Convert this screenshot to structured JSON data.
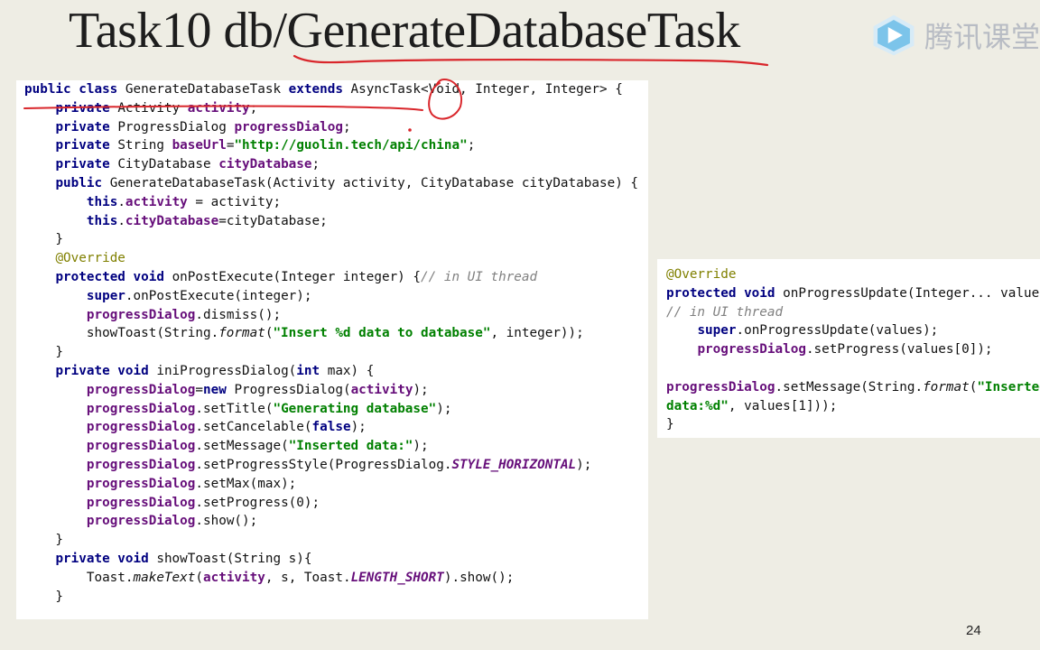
{
  "slide": {
    "title": "Task10 db/GenerateDatabaseTask",
    "page_number": "24"
  },
  "logo": {
    "text": "腾讯课堂",
    "icon": "play-icon"
  },
  "colors": {
    "background": "#eeede4",
    "keyword": "#000080",
    "field": "#660e7a",
    "string": "#008000",
    "comment": "#808080",
    "annotation": "#808000",
    "ink": "#d9262b"
  },
  "code_main": [
    [
      [
        "kw",
        "public class "
      ],
      [
        "",
        "GenerateDatabaseTask "
      ],
      [
        "kw",
        "extends "
      ],
      [
        "",
        "AsyncTask<Void, Integer, Integer> {"
      ]
    ],
    [
      [
        "",
        "    "
      ],
      [
        "kw",
        "private "
      ],
      [
        "",
        "Activity "
      ],
      [
        "fld",
        "activity"
      ],
      [
        "",
        ";"
      ]
    ],
    [
      [
        "",
        "    "
      ],
      [
        "kw",
        "private "
      ],
      [
        "",
        "ProgressDialog "
      ],
      [
        "fld",
        "progressDialog"
      ],
      [
        "",
        ";"
      ]
    ],
    [
      [
        "",
        "    "
      ],
      [
        "kw",
        "private "
      ],
      [
        "",
        "String "
      ],
      [
        "fld",
        "baseUrl"
      ],
      [
        "",
        "="
      ],
      [
        "str",
        "\"http://guolin.tech/api/china\""
      ],
      [
        "",
        ";"
      ]
    ],
    [
      [
        "",
        "    "
      ],
      [
        "kw",
        "private "
      ],
      [
        "",
        "CityDatabase "
      ],
      [
        "fld",
        "cityDatabase"
      ],
      [
        "",
        ";"
      ]
    ],
    [
      [
        "",
        "    "
      ],
      [
        "kw",
        "public "
      ],
      [
        "",
        "GenerateDatabaseTask(Activity activity, CityDatabase cityDatabase) {"
      ]
    ],
    [
      [
        "",
        "        "
      ],
      [
        "kw",
        "this"
      ],
      [
        "",
        "."
      ],
      [
        "fld",
        "activity"
      ],
      [
        "",
        " = activity;"
      ]
    ],
    [
      [
        "",
        "        "
      ],
      [
        "kw",
        "this"
      ],
      [
        "",
        "."
      ],
      [
        "fld",
        "cityDatabase"
      ],
      [
        "",
        "=cityDatabase;"
      ]
    ],
    [
      [
        "",
        "    }"
      ]
    ],
    [
      [
        "",
        "    "
      ],
      [
        "ann",
        "@Override"
      ]
    ],
    [
      [
        "",
        "    "
      ],
      [
        "kw",
        "protected void "
      ],
      [
        "",
        "onPostExecute(Integer integer) {"
      ],
      [
        "cmt",
        "// in UI thread"
      ]
    ],
    [
      [
        "",
        "        "
      ],
      [
        "kw",
        "super"
      ],
      [
        "",
        ".onPostExecute(integer);"
      ]
    ],
    [
      [
        "",
        "        "
      ],
      [
        "fld",
        "progressDialog"
      ],
      [
        "",
        ".dismiss();"
      ]
    ],
    [
      [
        "",
        "        showToast(String."
      ],
      [
        "itl",
        "format"
      ],
      [
        "",
        "("
      ],
      [
        "str",
        "\"Insert %d data to database\""
      ],
      [
        "",
        ", integer));"
      ]
    ],
    [
      [
        "",
        "    }"
      ]
    ],
    [
      [
        "",
        "    "
      ],
      [
        "kw",
        "private void "
      ],
      [
        "",
        "iniProgressDialog("
      ],
      [
        "kw",
        "int "
      ],
      [
        "",
        "max) {"
      ]
    ],
    [
      [
        "",
        "        "
      ],
      [
        "fld",
        "progressDialog"
      ],
      [
        "",
        "="
      ],
      [
        "kw",
        "new "
      ],
      [
        "",
        "ProgressDialog("
      ],
      [
        "fld",
        "activity"
      ],
      [
        "",
        ");"
      ]
    ],
    [
      [
        "",
        "        "
      ],
      [
        "fld",
        "progressDialog"
      ],
      [
        "",
        ".setTitle("
      ],
      [
        "str",
        "\"Generating database\""
      ],
      [
        "",
        ");"
      ]
    ],
    [
      [
        "",
        "        "
      ],
      [
        "fld",
        "progressDialog"
      ],
      [
        "",
        ".setCancelable("
      ],
      [
        "kw",
        "false"
      ],
      [
        "",
        ");"
      ]
    ],
    [
      [
        "",
        "        "
      ],
      [
        "fld",
        "progressDialog"
      ],
      [
        "",
        ".setMessage("
      ],
      [
        "str",
        "\"Inserted data:\""
      ],
      [
        "",
        ");"
      ]
    ],
    [
      [
        "",
        "        "
      ],
      [
        "fld",
        "progressDialog"
      ],
      [
        "",
        ".setProgressStyle(ProgressDialog."
      ],
      [
        "cst",
        "STYLE_HORIZONTAL"
      ],
      [
        "",
        ");"
      ]
    ],
    [
      [
        "",
        "        "
      ],
      [
        "fld",
        "progressDialog"
      ],
      [
        "",
        ".setMax(max);"
      ]
    ],
    [
      [
        "",
        "        "
      ],
      [
        "fld",
        "progressDialog"
      ],
      [
        "",
        ".setProgress(0);"
      ]
    ],
    [
      [
        "",
        "        "
      ],
      [
        "fld",
        "progressDialog"
      ],
      [
        "",
        ".show();"
      ]
    ],
    [
      [
        "",
        "    }"
      ]
    ],
    [
      [
        "",
        "    "
      ],
      [
        "kw",
        "private void "
      ],
      [
        "",
        "showToast(String s){"
      ]
    ],
    [
      [
        "",
        "        Toast."
      ],
      [
        "itl",
        "makeText"
      ],
      [
        "",
        "("
      ],
      [
        "fld",
        "activity"
      ],
      [
        "",
        ", s, Toast."
      ],
      [
        "cst",
        "LENGTH_SHORT"
      ],
      [
        "",
        ").show();"
      ]
    ],
    [
      [
        "",
        "    }"
      ]
    ]
  ],
  "code_side": [
    [
      [
        "ann",
        "@Override"
      ]
    ],
    [
      [
        "kw",
        "protected void "
      ],
      [
        "",
        "onProgressUpdate(Integer... values"
      ]
    ],
    [
      [
        "cmt",
        "// in UI thread"
      ]
    ],
    [
      [
        "",
        "    "
      ],
      [
        "kw",
        "super"
      ],
      [
        "",
        ".onProgressUpdate(values);"
      ]
    ],
    [
      [
        "",
        "    "
      ],
      [
        "fld",
        "progressDialog"
      ],
      [
        "",
        ".setProgress(values[0]);"
      ]
    ],
    [
      [
        "",
        ""
      ]
    ],
    [
      [
        "fld",
        "progressDialog"
      ],
      [
        "",
        ".setMessage(String."
      ],
      [
        "itl",
        "format"
      ],
      [
        "",
        "("
      ],
      [
        "str",
        "\"Inserted"
      ]
    ],
    [
      [
        "str",
        "data:%d\""
      ],
      [
        "",
        ", values[1]));"
      ]
    ],
    [
      [
        "",
        "}"
      ]
    ]
  ]
}
